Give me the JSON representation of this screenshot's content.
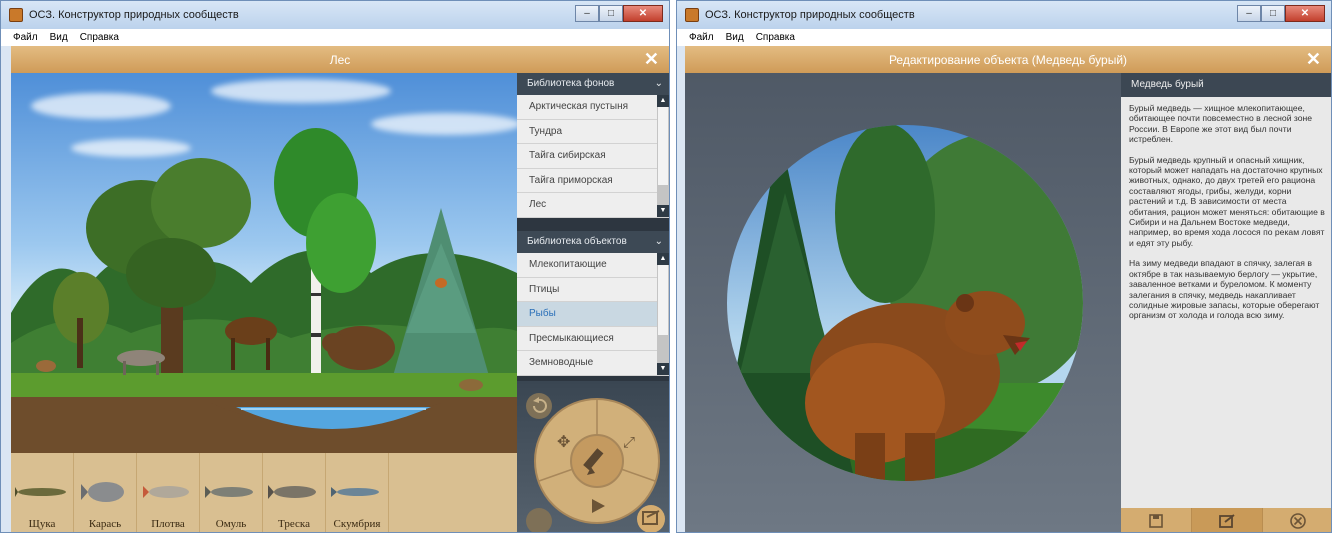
{
  "app": {
    "title": "ОСЗ. Конструктор природных сообществ"
  },
  "menu": [
    "Файл",
    "Вид",
    "Справка"
  ],
  "left_window": {
    "header": "Лес",
    "backgrounds_library": {
      "title": "Библиотека фонов",
      "items": [
        "Арктическая пустыня",
        "Тундра",
        "Тайга сибирская",
        "Тайга приморская",
        "Лес"
      ]
    },
    "objects_library": {
      "title": "Библиотека объектов",
      "items": [
        "Млекопитающие",
        "Птицы",
        "Рыбы",
        "Пресмыкающиеся",
        "Земноводные"
      ],
      "selected": "Рыбы"
    },
    "palette": [
      "Щука",
      "Карась",
      "Плотва",
      "Омуль",
      "Треска",
      "Скумбрия"
    ]
  },
  "right_window": {
    "header": "Редактирование объекта (Медведь бурый)",
    "info_title": "Медведь бурый",
    "paragraphs": [
      "Бурый медведь — хищное млекопитающее, обитающее почти повсеместно в лесной зоне России. В Европе же этот вид был почти истреблен.",
      "Бурый медведь крупный и опасный хищник, который может нападать на достаточно крупных животных, однако, до двух третей его рациона составляют ягоды, грибы, желуди, корни растений и т.д. В зависимости от места обитания, рацион может меняться: обитающие в Сибири и на Дальнем Востоке медведи, например, во время хода лосося по рекам ловят и едят эту рыбу.",
      "На зиму медведи впадают в спячку, залегая в октябре в так называемую берлогу — укрытие, заваленное ветками и буреломом. К моменту залегания в спячку, медведь накапливает солидные жировые запасы, которые оберегают организм от холода и голода всю зиму."
    ]
  },
  "colors": {
    "accent": "#d4ac70",
    "panel_dark": "#2d3640",
    "selected_text": "#2a6fb8"
  }
}
